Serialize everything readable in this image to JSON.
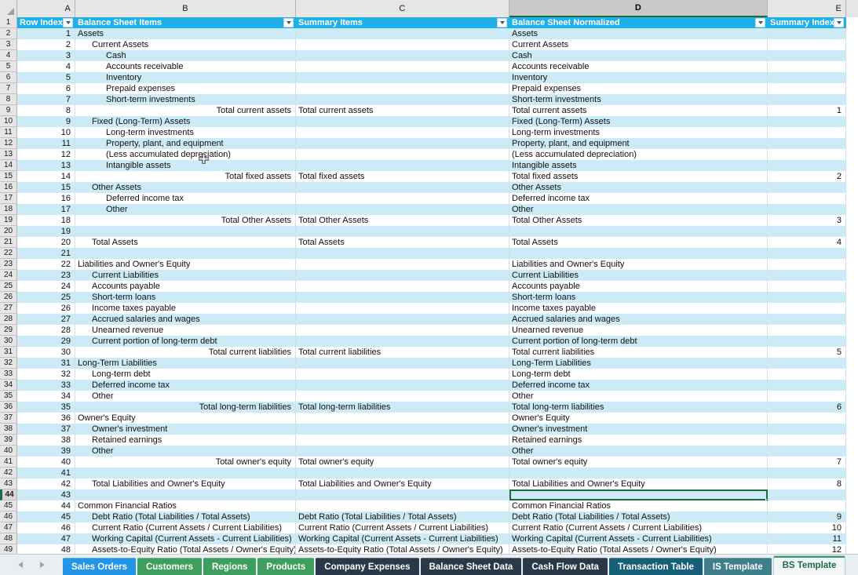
{
  "app": {
    "type": "spreadsheet",
    "active_cell": "D44"
  },
  "columns": {
    "letters": [
      "A",
      "B",
      "C",
      "D",
      "E"
    ],
    "selected_letter": "D"
  },
  "table_header": {
    "a": "Row Index",
    "b": "Balance Sheet Items",
    "c": "Summary Items",
    "d": "Balance Sheet Normalized",
    "e": "Summary Index",
    "filter_icon": "chevron-down-icon"
  },
  "colors": {
    "header_fill": "#1fb0e8",
    "band_fill": "#cdeaf7",
    "active_cell_border": "#1d6b42",
    "tab_active_text": "#1d6b42"
  },
  "rows": [
    {
      "n": 2,
      "a": "1",
      "b": "Assets",
      "indent": 0,
      "c": "",
      "d": "Assets",
      "e": ""
    },
    {
      "n": 3,
      "a": "2",
      "b": "Current Assets",
      "indent": 1,
      "c": "",
      "d": "Current Assets",
      "e": ""
    },
    {
      "n": 4,
      "a": "3",
      "b": "Cash",
      "indent": 2,
      "c": "",
      "d": "Cash",
      "e": ""
    },
    {
      "n": 5,
      "a": "4",
      "b": "Accounts receivable",
      "indent": 2,
      "c": "",
      "d": "Accounts receivable",
      "e": ""
    },
    {
      "n": 6,
      "a": "5",
      "b": "Inventory",
      "indent": 2,
      "c": "",
      "d": "Inventory",
      "e": ""
    },
    {
      "n": 7,
      "a": "6",
      "b": "Prepaid expenses",
      "indent": 2,
      "c": "",
      "d": "Prepaid expenses",
      "e": ""
    },
    {
      "n": 8,
      "a": "7",
      "b": "Short-term investments",
      "indent": 2,
      "c": "",
      "d": "Short-term investments",
      "e": ""
    },
    {
      "n": 9,
      "a": "8",
      "b": "Total current assets",
      "indent": -1,
      "c": "Total current assets",
      "d": "Total current assets",
      "e": "1"
    },
    {
      "n": 10,
      "a": "9",
      "b": "Fixed (Long-Term) Assets",
      "indent": 1,
      "c": "",
      "d": "Fixed (Long-Term) Assets",
      "e": ""
    },
    {
      "n": 11,
      "a": "10",
      "b": "Long-term investments",
      "indent": 2,
      "c": "",
      "d": "Long-term investments",
      "e": ""
    },
    {
      "n": 12,
      "a": "11",
      "b": "Property, plant, and equipment",
      "indent": 2,
      "c": "",
      "d": "Property, plant, and equipment",
      "e": ""
    },
    {
      "n": 13,
      "a": "12",
      "b": "(Less accumulated depreciation)",
      "indent": 2,
      "c": "",
      "d": "(Less accumulated depreciation)",
      "e": ""
    },
    {
      "n": 14,
      "a": "13",
      "b": "Intangible assets",
      "indent": 2,
      "c": "",
      "d": "Intangible assets",
      "e": ""
    },
    {
      "n": 15,
      "a": "14",
      "b": "Total fixed assets",
      "indent": -1,
      "c": "Total fixed assets",
      "d": "Total fixed assets",
      "e": "2"
    },
    {
      "n": 16,
      "a": "15",
      "b": "Other Assets",
      "indent": 1,
      "c": "",
      "d": "Other Assets",
      "e": ""
    },
    {
      "n": 17,
      "a": "16",
      "b": "Deferred income tax",
      "indent": 2,
      "c": "",
      "d": "Deferred income tax",
      "e": ""
    },
    {
      "n": 18,
      "a": "17",
      "b": "Other",
      "indent": 2,
      "c": "",
      "d": "Other",
      "e": ""
    },
    {
      "n": 19,
      "a": "18",
      "b": "Total Other Assets",
      "indent": -1,
      "c": "Total Other Assets",
      "d": "Total Other Assets",
      "e": "3"
    },
    {
      "n": 20,
      "a": "19",
      "b": "",
      "indent": 0,
      "c": "",
      "d": "",
      "e": ""
    },
    {
      "n": 21,
      "a": "20",
      "b": "Total Assets",
      "indent": 1,
      "c": "Total Assets",
      "d": "Total Assets",
      "e": "4"
    },
    {
      "n": 22,
      "a": "21",
      "b": "",
      "indent": 0,
      "c": "",
      "d": "",
      "e": ""
    },
    {
      "n": 23,
      "a": "22",
      "b": "Liabilities and Owner's Equity",
      "indent": 0,
      "c": "",
      "d": "Liabilities and Owner's Equity",
      "e": ""
    },
    {
      "n": 24,
      "a": "23",
      "b": "Current Liabilities",
      "indent": 1,
      "c": "",
      "d": "Current Liabilities",
      "e": ""
    },
    {
      "n": 25,
      "a": "24",
      "b": "Accounts payable",
      "indent": 1,
      "c": "",
      "d": "Accounts payable",
      "e": ""
    },
    {
      "n": 26,
      "a": "25",
      "b": "Short-term loans",
      "indent": 1,
      "c": "",
      "d": "Short-term loans",
      "e": ""
    },
    {
      "n": 27,
      "a": "26",
      "b": "Income taxes payable",
      "indent": 1,
      "c": "",
      "d": "Income taxes payable",
      "e": ""
    },
    {
      "n": 28,
      "a": "27",
      "b": "Accrued salaries and wages",
      "indent": 1,
      "c": "",
      "d": "Accrued salaries and wages",
      "e": ""
    },
    {
      "n": 29,
      "a": "28",
      "b": "Unearned revenue",
      "indent": 1,
      "c": "",
      "d": "Unearned revenue",
      "e": ""
    },
    {
      "n": 30,
      "a": "29",
      "b": "Current portion of long-term debt",
      "indent": 1,
      "c": "",
      "d": "Current portion of long-term debt",
      "e": ""
    },
    {
      "n": 31,
      "a": "30",
      "b": "Total current liabilities",
      "indent": -1,
      "c": "Total current liabilities",
      "d": "Total current liabilities",
      "e": "5"
    },
    {
      "n": 32,
      "a": "31",
      "b": "Long-Term Liabilities",
      "indent": 0,
      "c": "",
      "d": "Long-Term Liabilities",
      "e": ""
    },
    {
      "n": 33,
      "a": "32",
      "b": "Long-term debt",
      "indent": 1,
      "c": "",
      "d": "Long-term debt",
      "e": ""
    },
    {
      "n": 34,
      "a": "33",
      "b": "Deferred income tax",
      "indent": 1,
      "c": "",
      "d": "Deferred income tax",
      "e": ""
    },
    {
      "n": 35,
      "a": "34",
      "b": "Other",
      "indent": 1,
      "c": "",
      "d": "Other",
      "e": ""
    },
    {
      "n": 36,
      "a": "35",
      "b": "Total long-term liabilities",
      "indent": -1,
      "c": "Total long-term liabilities",
      "d": "Total long-term liabilities",
      "e": "6"
    },
    {
      "n": 37,
      "a": "36",
      "b": "Owner's Equity",
      "indent": 0,
      "c": "",
      "d": "Owner's Equity",
      "e": ""
    },
    {
      "n": 38,
      "a": "37",
      "b": "Owner's investment",
      "indent": 1,
      "c": "",
      "d": "Owner's investment",
      "e": ""
    },
    {
      "n": 39,
      "a": "38",
      "b": "Retained earnings",
      "indent": 1,
      "c": "",
      "d": "Retained earnings",
      "e": ""
    },
    {
      "n": 40,
      "a": "39",
      "b": "Other",
      "indent": 1,
      "c": "",
      "d": "Other",
      "e": ""
    },
    {
      "n": 41,
      "a": "40",
      "b": "Total owner's equity",
      "indent": -1,
      "c": "Total owner's equity",
      "d": "Total owner's equity",
      "e": "7"
    },
    {
      "n": 42,
      "a": "41",
      "b": "",
      "indent": 0,
      "c": "",
      "d": "",
      "e": ""
    },
    {
      "n": 43,
      "a": "42",
      "b": "Total Liabilities and Owner's Equity",
      "indent": 1,
      "c": "Total Liabilities and Owner's Equity",
      "d": "Total Liabilities and Owner's Equity",
      "e": "8"
    },
    {
      "n": 44,
      "a": "43",
      "b": "",
      "indent": 0,
      "c": "",
      "d": "",
      "e": ""
    },
    {
      "n": 45,
      "a": "44",
      "b": "Common Financial Ratios",
      "indent": 0,
      "c": "",
      "d": "Common Financial Ratios",
      "e": ""
    },
    {
      "n": 46,
      "a": "45",
      "b": "Debt Ratio (Total Liabilities / Total Assets)",
      "indent": 1,
      "c": "Debt Ratio (Total Liabilities / Total Assets)",
      "d": "Debt Ratio (Total Liabilities / Total Assets)",
      "e": "9"
    },
    {
      "n": 47,
      "a": "46",
      "b": "Current Ratio (Current Assets / Current Liabilities)",
      "indent": 1,
      "c": "Current Ratio (Current Assets / Current Liabilities)",
      "d": "Current Ratio (Current Assets / Current Liabilities)",
      "e": "10"
    },
    {
      "n": 48,
      "a": "47",
      "b": "Working Capital (Current Assets - Current Liabilities)",
      "indent": 1,
      "c": "Working Capital (Current Assets - Current Liabilities)",
      "d": "Working Capital (Current Assets - Current Liabilities)",
      "e": "11"
    },
    {
      "n": 49,
      "a": "48",
      "b": "Assets-to-Equity Ratio (Total Assets / Owner's Equity)",
      "indent": 1,
      "c": "Assets-to-Equity Ratio (Total Assets / Owner's Equity)",
      "d": "Assets-to-Equity Ratio (Total Assets / Owner's Equity)",
      "e": "12"
    }
  ],
  "sheet_tabs": [
    {
      "label": "Sales Orders",
      "color": "#2196e8",
      "active": false
    },
    {
      "label": "Customers",
      "color": "#3e9e5e",
      "active": false
    },
    {
      "label": "Regions",
      "color": "#3e9e5e",
      "active": false
    },
    {
      "label": "Products",
      "color": "#3e9e5e",
      "active": false
    },
    {
      "label": "Company Expenses",
      "color": "#28394a",
      "active": false
    },
    {
      "label": "Balance Sheet Data",
      "color": "#28394a",
      "active": false
    },
    {
      "label": "Cash Flow Data",
      "color": "#28394a",
      "active": false
    },
    {
      "label": "Transaction Table",
      "color": "#175f78",
      "active": false
    },
    {
      "label": "IS Template",
      "color": "#3f7f8c",
      "active": false
    },
    {
      "label": "BS Template",
      "color": "#f4f7f8",
      "active": true
    }
  ],
  "nav": {
    "prev_icon": "triangle-left-icon",
    "next_icon": "triangle-right-icon"
  }
}
